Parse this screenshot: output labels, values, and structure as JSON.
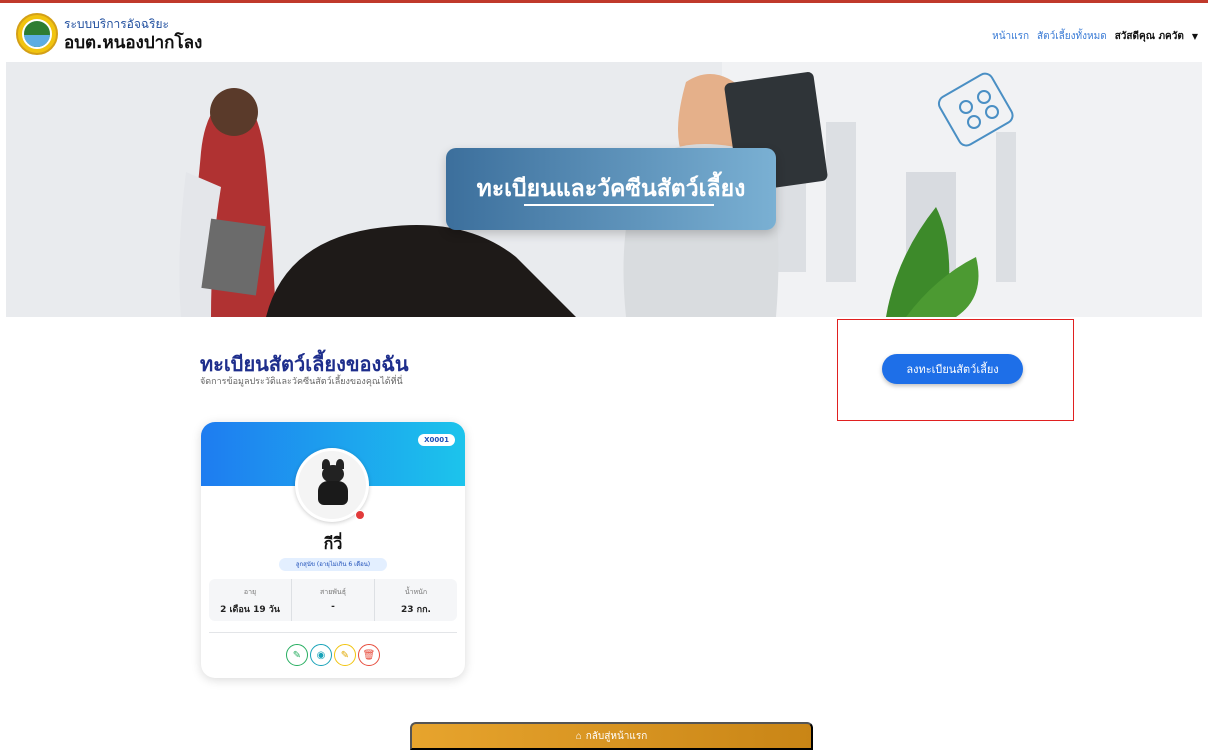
{
  "brand": {
    "subtitle": "ระบบบริการอัจฉริยะ",
    "title": "อบต.หนองปากโลง"
  },
  "nav": {
    "home": "หน้าแรก",
    "all_pets": "สัตว์เลี้ยงทั้งหมด",
    "user": "สวัสดีคุณ ภควัต",
    "caret": "▼"
  },
  "hero": {
    "title": "ทะเบียนและวัคซีนสัตว์เลี้ยง"
  },
  "main": {
    "title": "ทะเบียนสัตว์เลี้ยงของฉัน",
    "subtitle": "จัดการข้อมูลประวัติและวัคซีนสัตว์เลี้ยงของคุณได้ที่นี่",
    "register_button": "ลงทะเบียนสัตว์เลี้ยง"
  },
  "pet": {
    "id": "X0001",
    "name": "กีวี่",
    "badge": "ลูกสุนัข (อายุไม่เกิน 6 เดือน)",
    "stats": [
      {
        "label": "อายุ",
        "value": "2 เดือน 19 วัน"
      },
      {
        "label": "สายพันธุ์",
        "value": "-"
      },
      {
        "label": "น้ำหนัก",
        "value": "23 กก."
      }
    ],
    "actions": [
      {
        "name": "vaccine",
        "icon": "✎",
        "color": "#27ae60"
      },
      {
        "name": "view",
        "icon": "◉",
        "color": "#17a2b8"
      },
      {
        "name": "edit",
        "icon": "✎",
        "color": "#e0a800"
      },
      {
        "name": "delete",
        "icon": "🗑",
        "color": "#e74c3c"
      }
    ]
  },
  "footer": {
    "back_home": "กลับสู่หน้าแรก",
    "home_icon": "⌂"
  }
}
